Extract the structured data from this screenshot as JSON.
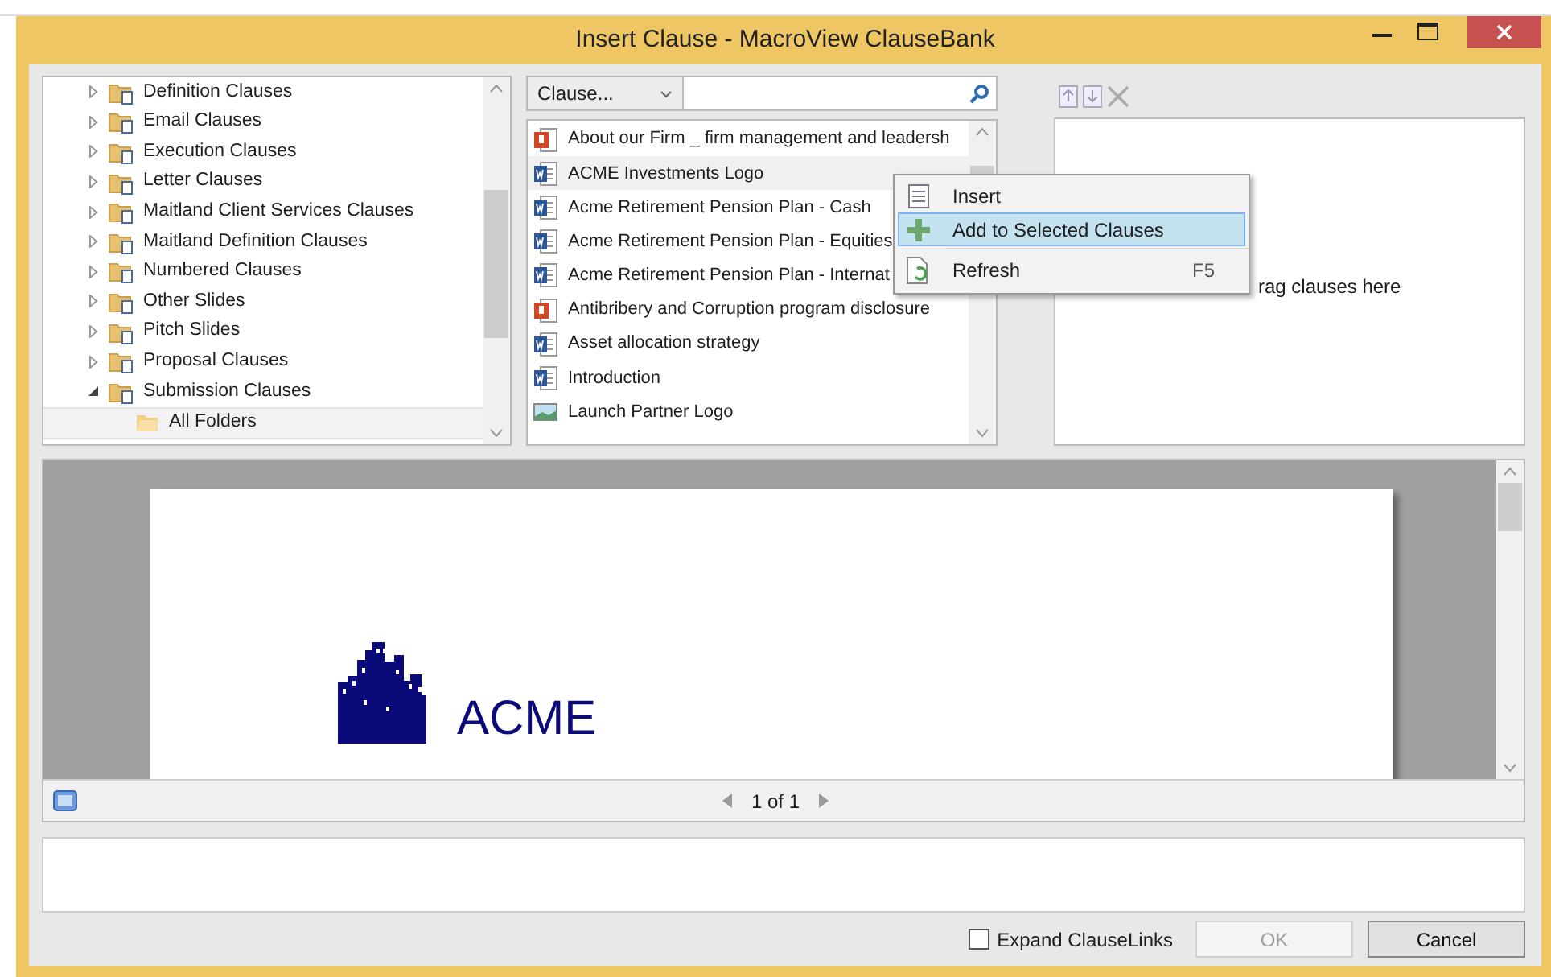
{
  "window": {
    "title": "Insert Clause - MacroView ClauseBank"
  },
  "tree": [
    {
      "label": "Definition Clauses",
      "expanded": false,
      "selected": false
    },
    {
      "label": "Email Clauses",
      "expanded": false,
      "selected": false
    },
    {
      "label": "Execution Clauses",
      "expanded": false,
      "selected": false
    },
    {
      "label": "Letter Clauses",
      "expanded": false,
      "selected": false
    },
    {
      "label": "Maitland Client Services Clauses",
      "expanded": false,
      "selected": false
    },
    {
      "label": "Maitland Definition Clauses",
      "expanded": false,
      "selected": false
    },
    {
      "label": "Numbered Clauses",
      "expanded": false,
      "selected": false
    },
    {
      "label": "Other Slides",
      "expanded": false,
      "selected": false
    },
    {
      "label": "Pitch Slides",
      "expanded": false,
      "selected": false
    },
    {
      "label": "Proposal Clauses",
      "expanded": false,
      "selected": false
    },
    {
      "label": "Submission Clauses",
      "expanded": true,
      "selected": false,
      "children": [
        {
          "label": "All Folders",
          "selected": true
        }
      ]
    }
  ],
  "clause_filter": {
    "value": "Clause..."
  },
  "clauses": [
    {
      "label": "About our Firm _  firm management and leadersh",
      "kind": "ppt",
      "selected": false
    },
    {
      "label": "ACME Investments Logo",
      "kind": "word",
      "selected": true
    },
    {
      "label": "Acme Retirement Pension Plan - Cash",
      "kind": "word",
      "selected": false
    },
    {
      "label": "Acme Retirement Pension Plan - Equities",
      "kind": "word",
      "selected": false
    },
    {
      "label": "Acme Retirement Pension Plan - Internat",
      "kind": "word",
      "selected": false
    },
    {
      "label": "Antibribery and Corruption program disclosure",
      "kind": "ppt",
      "selected": false
    },
    {
      "label": "Asset allocation strategy",
      "kind": "word",
      "selected": false
    },
    {
      "label": "Introduction",
      "kind": "word",
      "selected": false
    },
    {
      "label": "Launch Partner Logo",
      "kind": "image",
      "selected": false
    }
  ],
  "context_menu": [
    {
      "label": "Insert",
      "kind": "insert",
      "selected": false
    },
    {
      "label": "Add to Selected Clauses",
      "kind": "add",
      "selected": true
    },
    {
      "label": "Refresh",
      "kind": "refresh",
      "shortcut": "F5",
      "selected": false
    }
  ],
  "selected_clauses": {
    "hint": "rag clauses here"
  },
  "preview": {
    "logo_text": "ACME",
    "pager": "1 of 1"
  },
  "footer": {
    "expand_clauselinks": {
      "label": "Expand ClauseLinks",
      "checked": false
    },
    "buttons": [
      {
        "label": "OK",
        "disabled": true
      },
      {
        "label": "Cancel",
        "disabled": false
      }
    ]
  }
}
